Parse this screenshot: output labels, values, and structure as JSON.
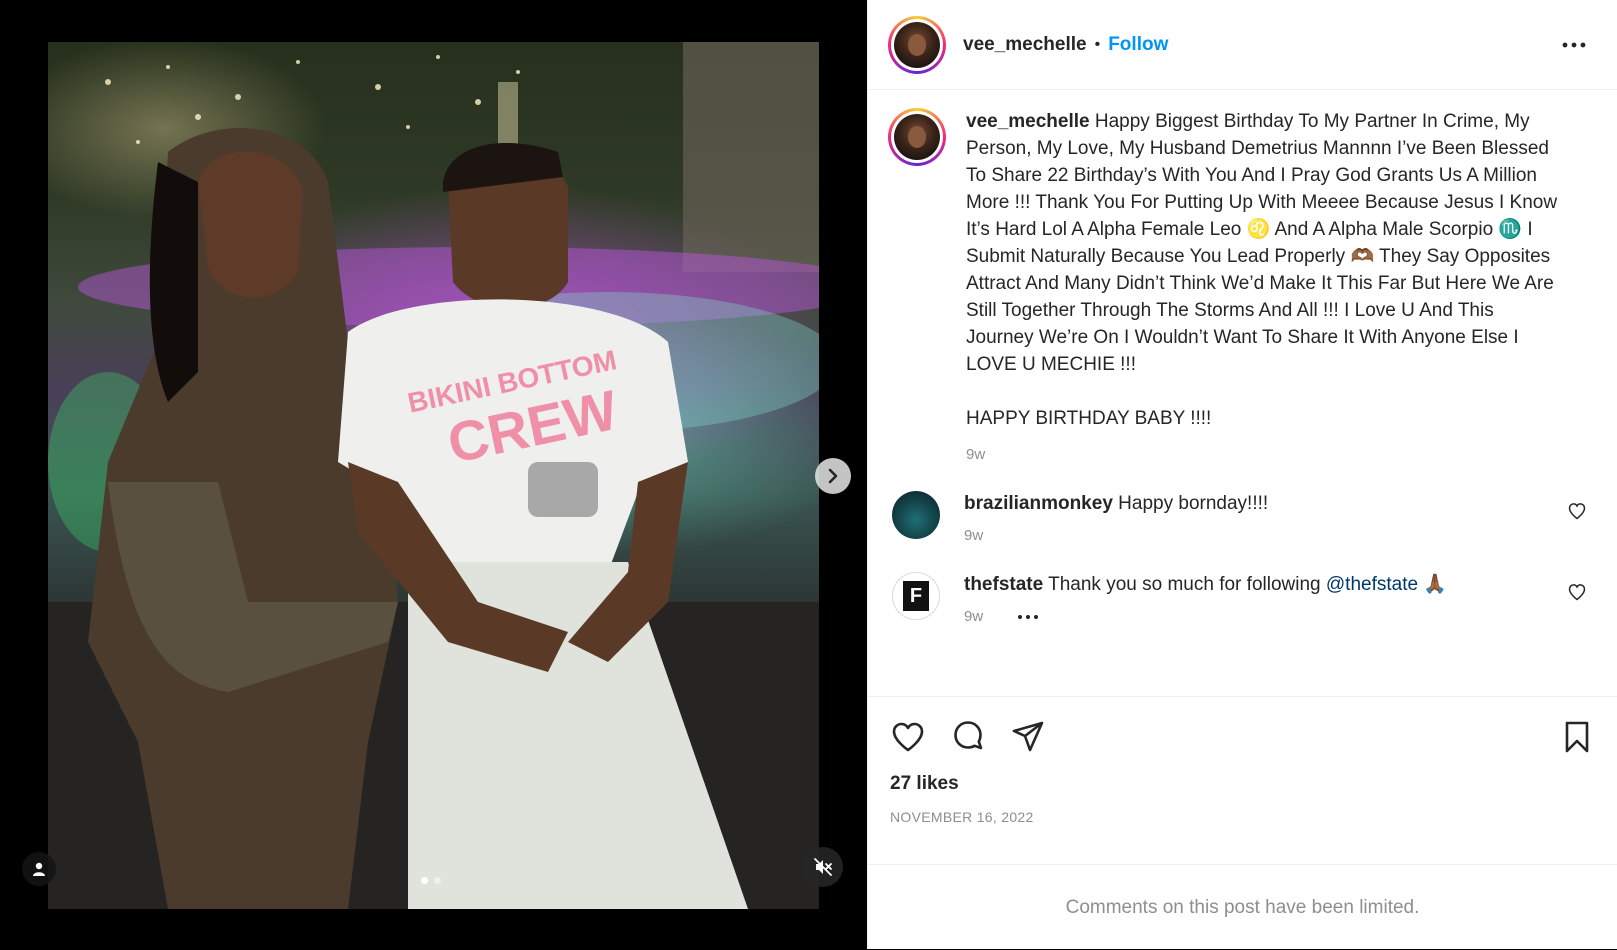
{
  "post": {
    "username": "vee_mechelle",
    "separator": "•",
    "follow_label": "Follow",
    "caption": "Happy Biggest Birthday To My Partner In Crime, My Person, My Love, My Husband Demetrius Mannnn I’ve Been Blessed To Share 22 Birthday’s With You And I Pray God Grants Us A Million More !!! Thank You For Putting Up With Meeee Because Jesus I Know It’s Hard Lol A Alpha Female Leo ♌️ And A Alpha Male Scorpio ♏️ I Submit Naturally Because You Lead Properly 🫶🏾 They Say Opposites Attract And Many Didn’t Think We’d Make It This Far But Here We Are Still Together Through The Storms And All !!! I Love U And This Journey We’re On I Wouldn’t Want To Share It With Anyone Else I LOVE U MECHIE !!!\n\nHAPPY BIRTHDAY BABY !!!!",
    "caption_time": "9w",
    "likes": "27 likes",
    "date": "NOVEMBER 16, 2022",
    "comments_limited": "Comments on this post have been limited."
  },
  "comments": [
    {
      "username": "brazilianmonkey",
      "text": "Happy bornday!!!!",
      "time": "9w"
    },
    {
      "username": "thefstate",
      "text": "Thank you so much for following",
      "mention": "@thefstate",
      "emoji": "🙏🏾",
      "time": "9w",
      "avatar_letter": "F"
    }
  ],
  "media": {
    "carousel_total": 2,
    "carousel_active": 1,
    "shirt_text_line1": "BIKINI BOTTOM",
    "shirt_text_line2": "CREW"
  },
  "icons": {
    "more": "more-horizontal-icon",
    "next": "chevron-right-icon",
    "tag": "user-tag-icon",
    "mute": "volume-muted-icon",
    "like": "heart-icon",
    "comment": "comment-icon",
    "share": "paper-plane-icon",
    "save": "bookmark-icon"
  },
  "colors": {
    "follow": "#0095f6",
    "mention": "#00376b",
    "secondary_text": "#8e8e8e"
  }
}
